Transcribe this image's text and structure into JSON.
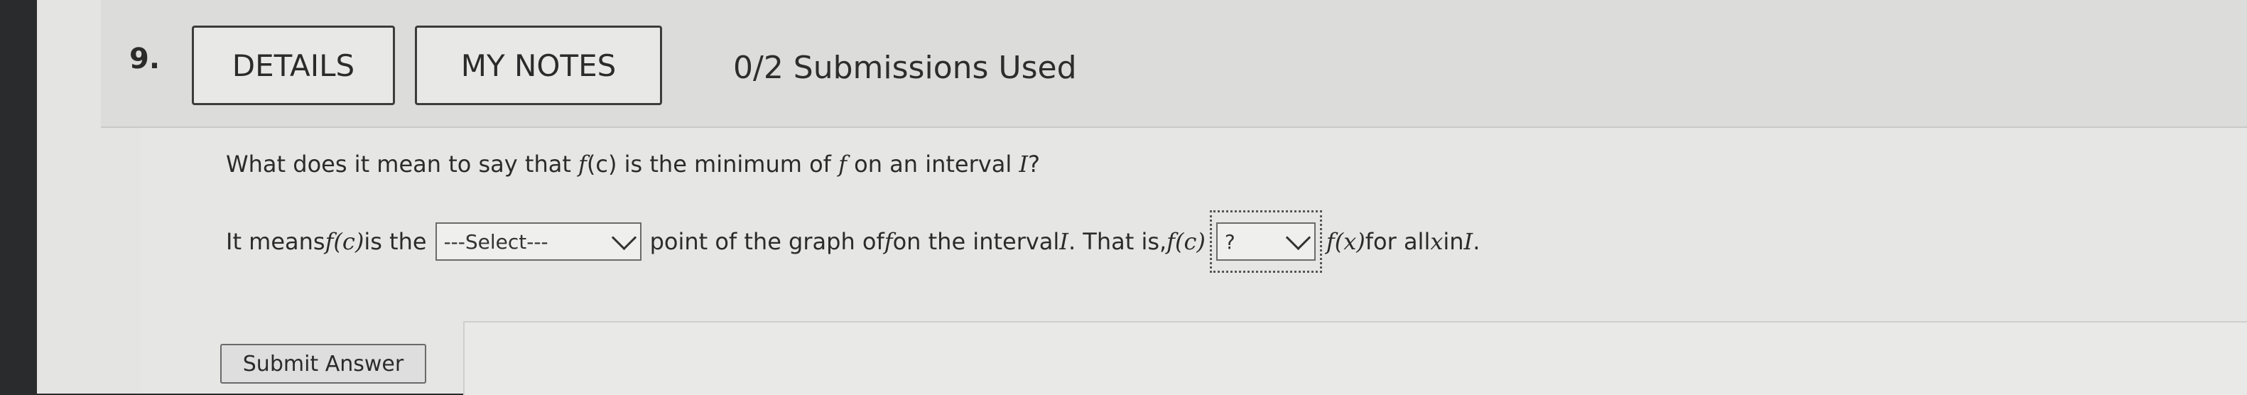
{
  "question": {
    "number": "9.",
    "buttons": {
      "details": "DETAILS",
      "my_notes": "MY NOTES"
    },
    "submissions": "0/2 Submissions Used",
    "prompt": {
      "pre": "What does it mean to say that ",
      "fc": "f",
      "c1": "(c)",
      "mid": " is the minimum of ",
      "f": "f",
      "post": " on an interval ",
      "interval": "I",
      "q": "?"
    },
    "answer": {
      "t1": "It means ",
      "fc": "f(c)",
      "t2": " is the",
      "select1": "---Select---",
      "t3": "point of the graph of ",
      "f": "f",
      "t4": " on the interval ",
      "interval": "I",
      "t5": ". That is, ",
      "fc2": "f(c)",
      "select2": "?",
      "fx": "f(x)",
      "t6": " for all ",
      "x": "x",
      "t7": " in ",
      "interval2": "I",
      "t8": "."
    },
    "submit_label": "Submit Answer"
  }
}
